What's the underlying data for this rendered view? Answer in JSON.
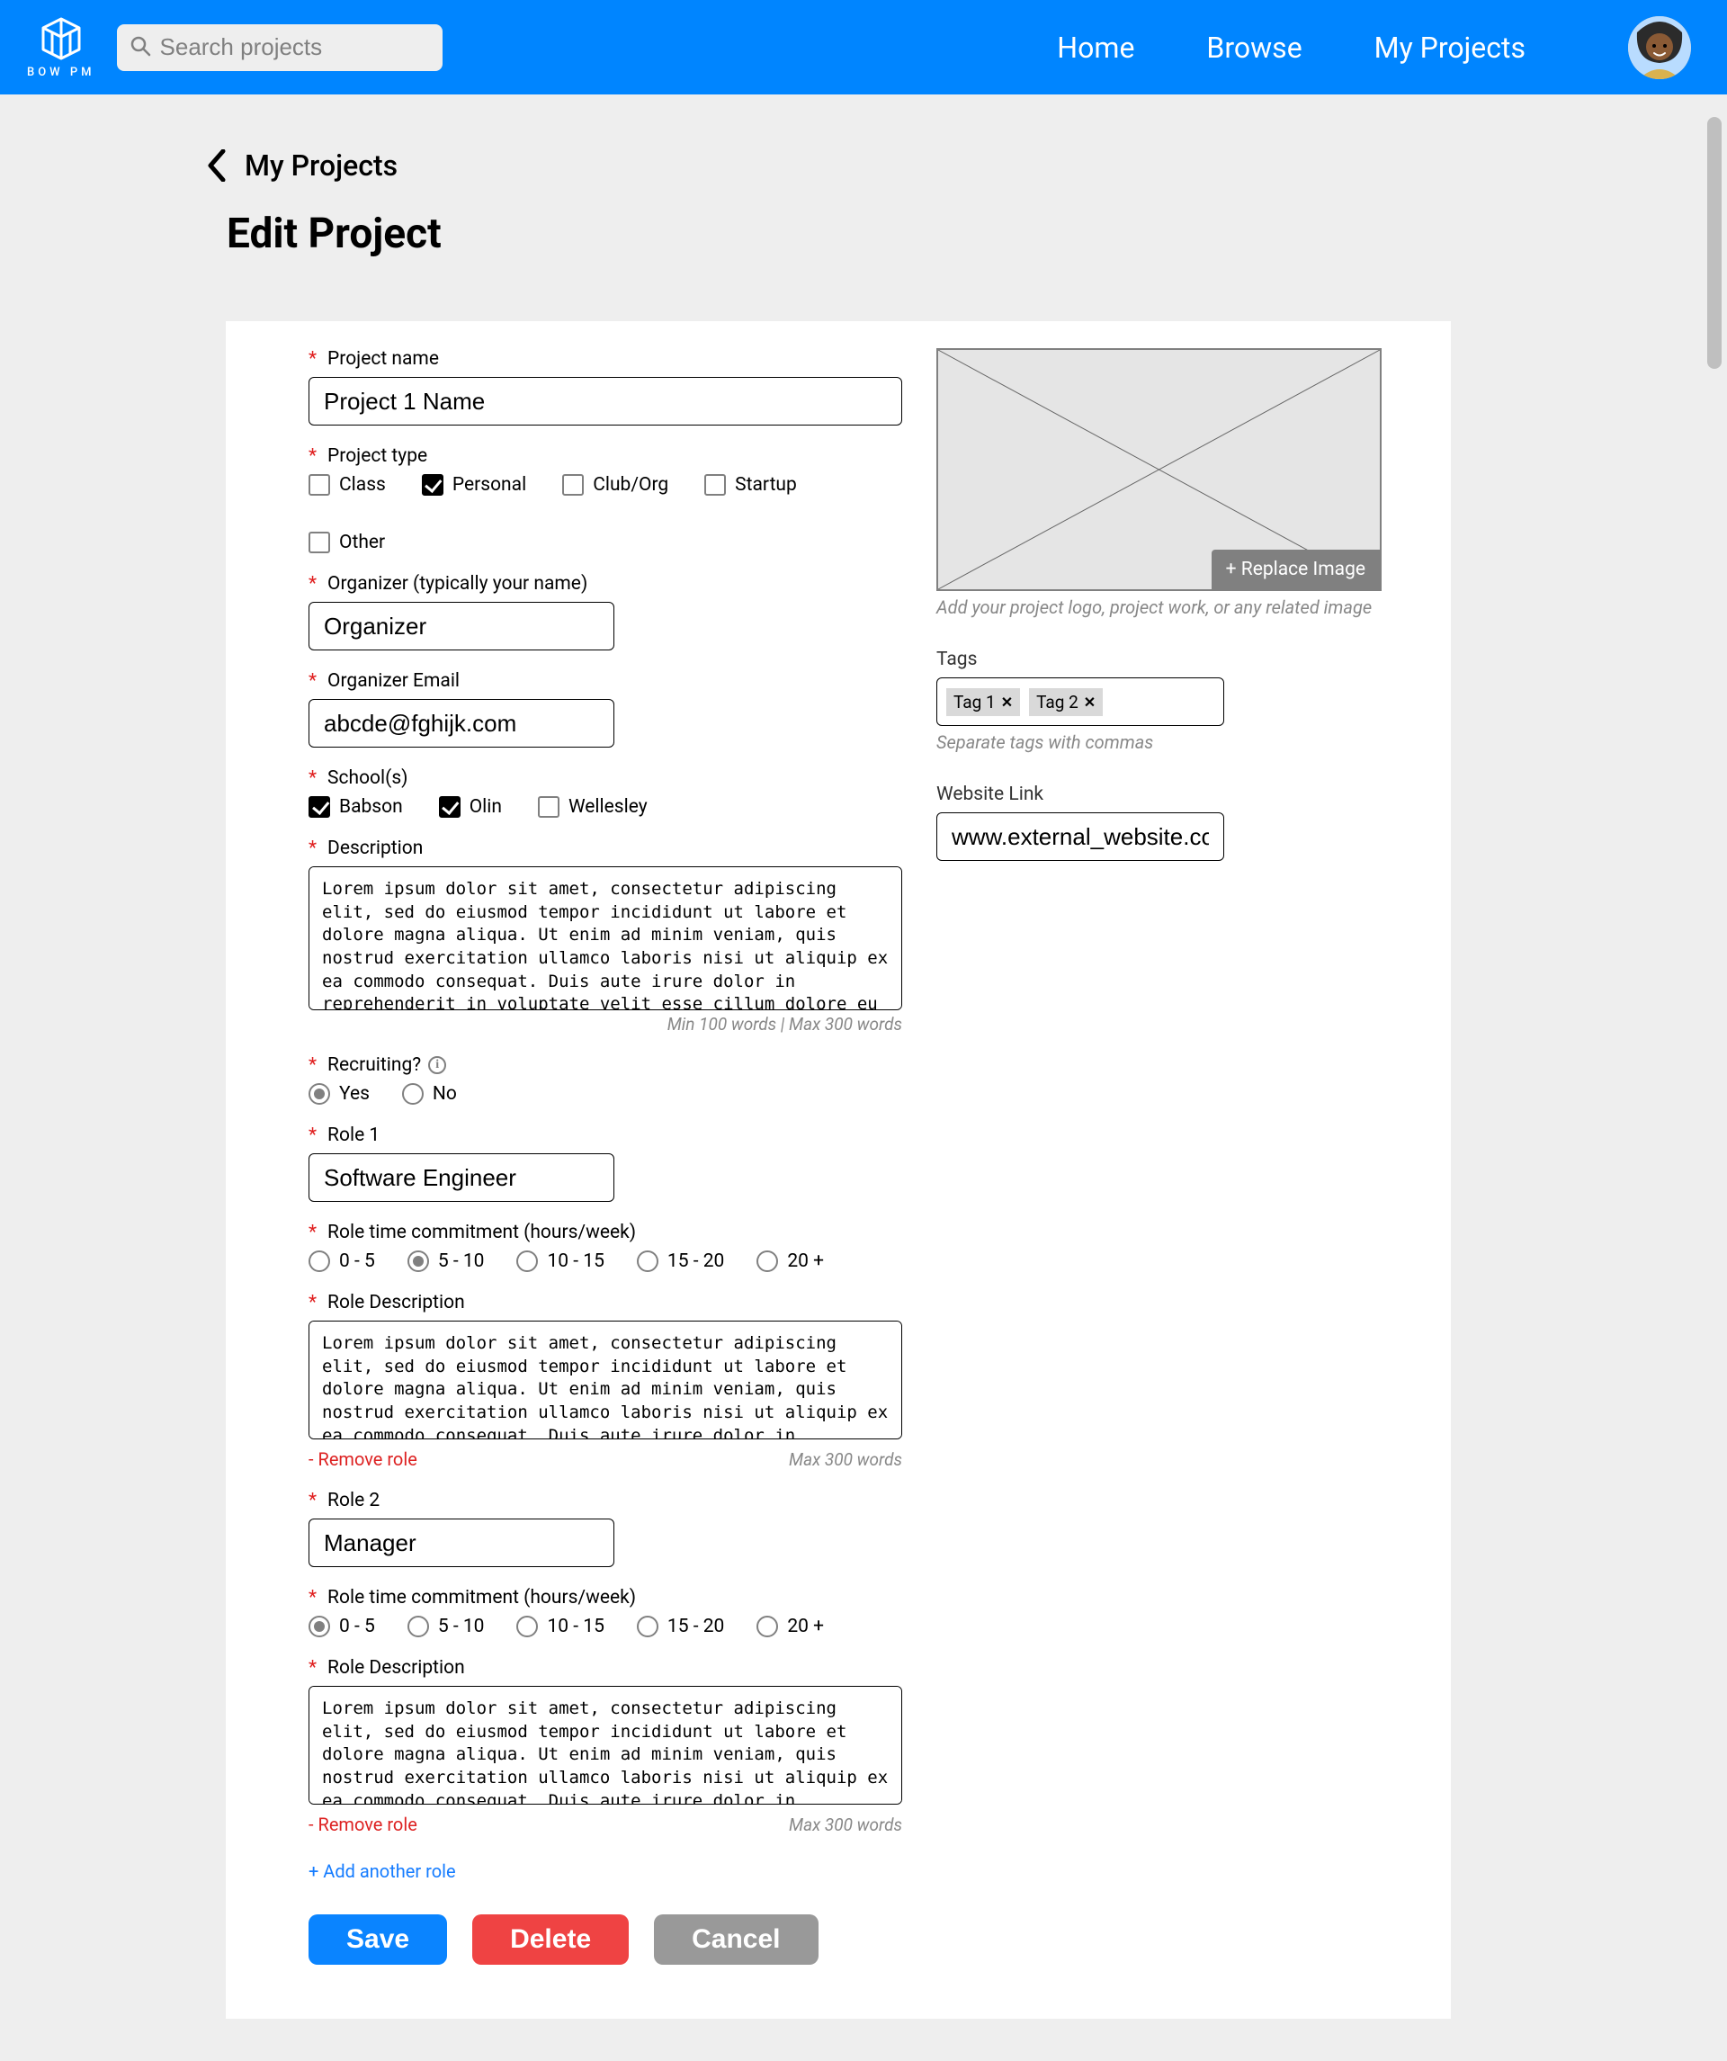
{
  "header": {
    "brand_text": "BOW PM",
    "search_placeholder": "Search projects",
    "nav": {
      "home": "Home",
      "browse": "Browse",
      "my_projects": "My Projects"
    }
  },
  "page": {
    "back_label": "My Projects",
    "title": "Edit Project"
  },
  "form": {
    "project_name": {
      "label": "Project name",
      "value": "Project 1 Name"
    },
    "project_type": {
      "label": "Project type",
      "options": [
        {
          "label": "Class",
          "checked": false
        },
        {
          "label": "Personal",
          "checked": true
        },
        {
          "label": "Club/Org",
          "checked": false
        },
        {
          "label": "Startup",
          "checked": false
        },
        {
          "label": "Other",
          "checked": false
        }
      ]
    },
    "organizer": {
      "label": "Organizer (typically your name)",
      "value": "Organizer"
    },
    "organizer_email": {
      "label": "Organizer Email",
      "value": "abcde@fghijk.com"
    },
    "schools": {
      "label": "School(s)",
      "options": [
        {
          "label": "Babson",
          "checked": true
        },
        {
          "label": "Olin",
          "checked": true
        },
        {
          "label": "Wellesley",
          "checked": false
        }
      ]
    },
    "description": {
      "label": "Description",
      "value": "Lorem ipsum dolor sit amet, consectetur adipiscing elit, sed do eiusmod tempor incididunt ut labore et dolore magna aliqua. Ut enim ad minim veniam, quis nostrud exercitation ullamco laboris nisi ut aliquip ex ea commodo consequat. Duis aute irure dolor in reprehenderit in voluptate velit esse cillum dolore eu fugiat nulla pariatur. Excepteur sint occaecat cupidatat non proident, sunt in culpa qui officia deserunt mollit anim id est laborum.",
      "helper": "Min 100 words | Max 300 words"
    },
    "recruiting": {
      "label": "Recruiting?",
      "options": [
        {
          "label": "Yes",
          "selected": true
        },
        {
          "label": "No",
          "selected": false
        }
      ]
    },
    "time_options": [
      "0 - 5",
      "5 - 10",
      "10 - 15",
      "15 - 20",
      "20 +"
    ],
    "roles": [
      {
        "title_label": "Role 1",
        "title_value": "Software Engineer",
        "commit_label": "Role time commitment (hours/week)",
        "commit_selected": 1,
        "desc_label": "Role Description",
        "desc_value": "Lorem ipsum dolor sit amet, consectetur adipiscing elit, sed do eiusmod tempor incididunt ut labore et dolore magna aliqua. Ut enim ad minim veniam, quis nostrud exercitation ullamco laboris nisi ut aliquip ex ea commodo consequat. Duis aute irure dolor in reprehenderit in voluptate velit esse cillum dolore eu fugiat nulla pariatur. Excepteur sint occaecat cupidatat non proident, sunt in culpa qui officia deserunt mollit anim id est laborum.",
        "desc_helper": "Max 300 words",
        "remove_label": "- Remove role"
      },
      {
        "title_label": "Role 2",
        "title_value": "Manager",
        "commit_label": "Role time commitment (hours/week)",
        "commit_selected": 0,
        "desc_label": "Role Description",
        "desc_value": "Lorem ipsum dolor sit amet, consectetur adipiscing elit, sed do eiusmod tempor incididunt ut labore et dolore magna aliqua. Ut enim ad minim veniam, quis nostrud exercitation ullamco laboris nisi ut aliquip ex ea commodo consequat. Duis aute irure dolor in reprehenderit in voluptate velit esse cillum dolore eu fugiat nulla pariatur. Excepteur sint occaecat cupidatat non proident, sunt in culpa qui officia deserunt mollit anim id est laborum.",
        "desc_helper": "Max 300 words",
        "remove_label": "- Remove role"
      }
    ],
    "add_role_label": "+ Add another role",
    "buttons": {
      "save": "Save",
      "delete": "Delete",
      "cancel": "Cancel"
    }
  },
  "side": {
    "replace_label": "+ Replace Image",
    "image_caption": "Add your project logo, project work, or any related image",
    "tags": {
      "label": "Tags",
      "items": [
        "Tag 1",
        "Tag 2"
      ],
      "helper": "Separate tags with commas"
    },
    "website": {
      "label": "Website Link",
      "value": "www.external_website.com"
    }
  }
}
